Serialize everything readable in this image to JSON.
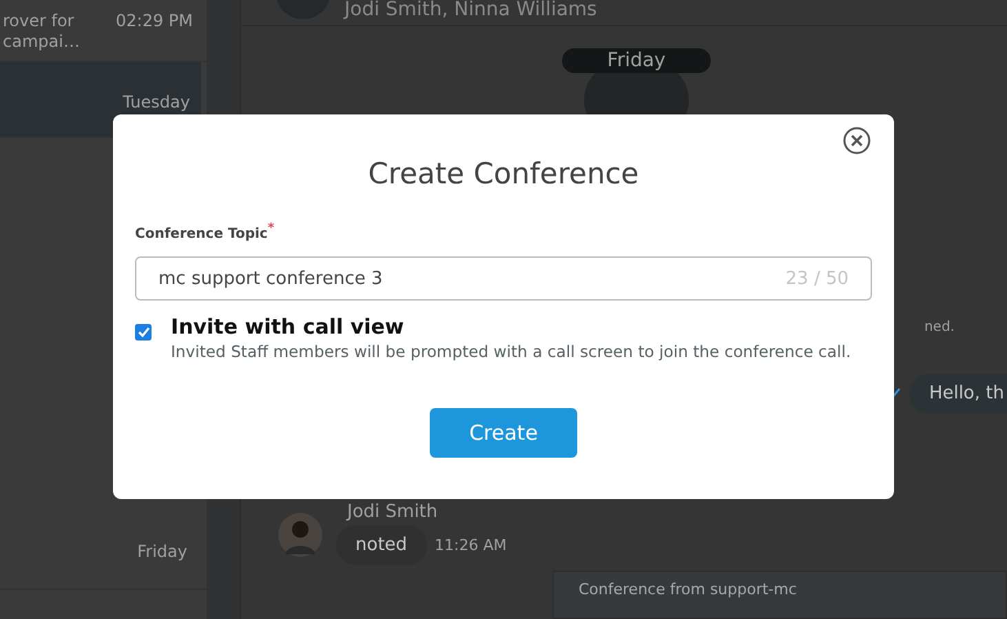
{
  "sidebar": {
    "items": [
      {
        "preview": [
          "rover for",
          "campai…"
        ],
        "time": "02:29 PM",
        "selected": false
      },
      {
        "time": "Tuesday",
        "selected": true
      },
      {
        "time": "Friday",
        "selected": false
      }
    ]
  },
  "chat": {
    "header": {
      "participants": "Jodi Smith, Ninna Williams"
    },
    "date_divider": "Friday",
    "messages": [
      {
        "kind": "status",
        "text": "ned."
      },
      {
        "kind": "outgoing",
        "text": "Hello, th"
      },
      {
        "kind": "incoming",
        "sender": "Jodi Smith",
        "text": "noted",
        "time": "11:26 AM"
      },
      {
        "kind": "card",
        "text": "Conference from support-mc"
      }
    ]
  },
  "dialog": {
    "title": "Create Conference",
    "field": {
      "label": "Conference Topic",
      "required_mark": "*",
      "value": "mc support conference 3",
      "counter": "23 / 50"
    },
    "option": {
      "label": "Invite with call view",
      "description": "Invited Staff members will be prompted with a call screen to join the conference call.",
      "checked": true
    },
    "button": "Create"
  }
}
